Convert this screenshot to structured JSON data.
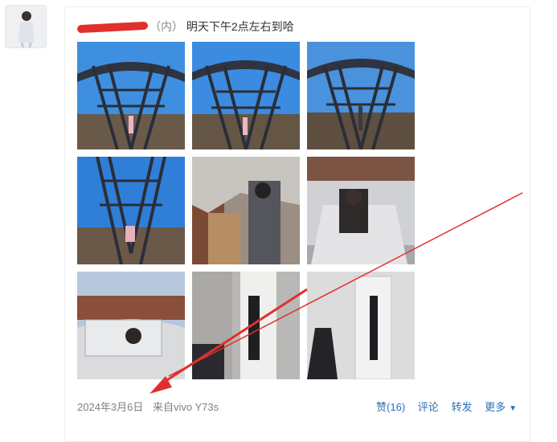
{
  "post": {
    "name_visible": "（内）",
    "text": "明天下午2点左右到哈"
  },
  "footer": {
    "date": "2024年3月6日",
    "source": "来自vivo Y73s"
  },
  "actions": {
    "like": "赞(16)",
    "comment": "评论",
    "forward": "转发",
    "more": "更多"
  },
  "colors": {
    "link": "#2a6fb8",
    "annotation": "#e0302e"
  }
}
